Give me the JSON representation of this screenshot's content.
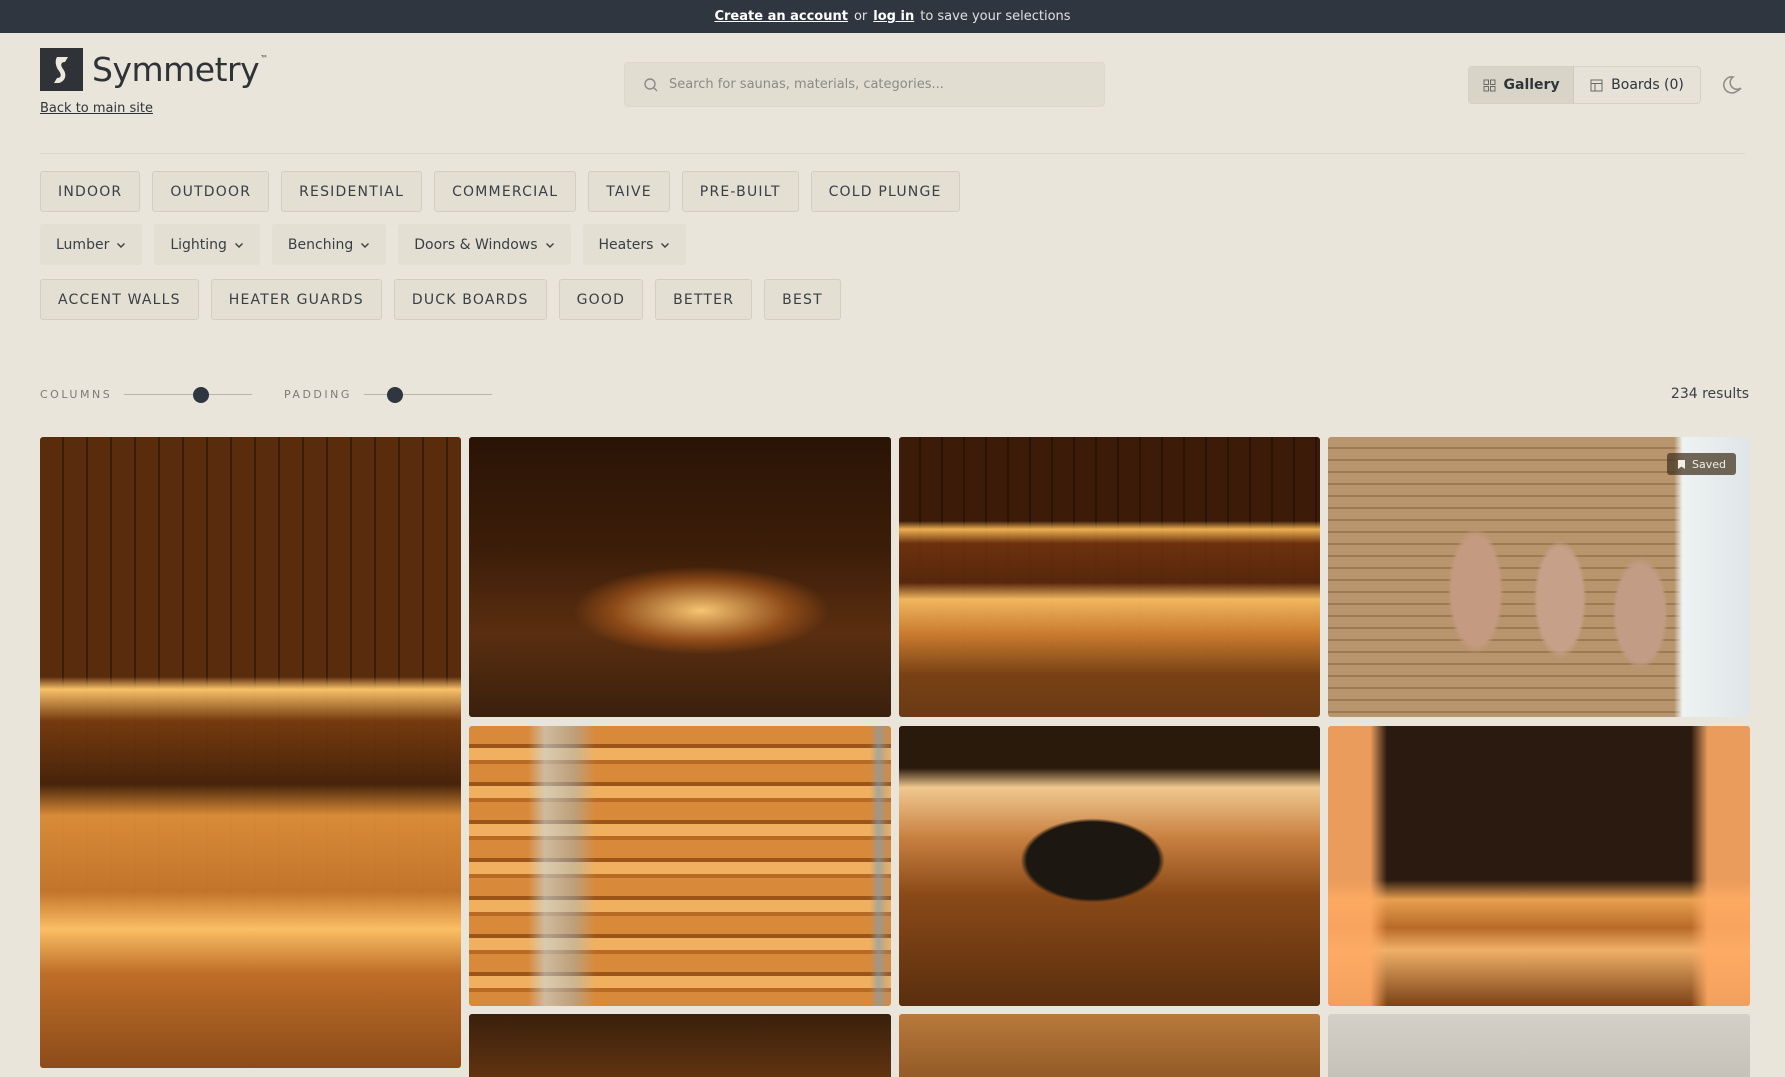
{
  "banner": {
    "create_account": "Create an account",
    "or": "or",
    "log_in": "log in",
    "suffix": "to save your selections"
  },
  "header": {
    "brand": "Symmetry",
    "trademark": "™",
    "back_link": "Back to main site",
    "search_placeholder": "Search for saunas, materials, categories...",
    "gallery_label": "Gallery",
    "boards_label": "Boards (0)"
  },
  "filters": {
    "categories": [
      "INDOOR",
      "OUTDOOR",
      "RESIDENTIAL",
      "COMMERCIAL",
      "TAIVE",
      "PRE-BUILT",
      "COLD PLUNGE"
    ],
    "dropdowns": [
      "Lumber",
      "Lighting",
      "Benching",
      "Doors & Windows",
      "Heaters"
    ],
    "tags": [
      "ACCENT WALLS",
      "HEATER GUARDS",
      "DUCK BOARDS",
      "GOOD",
      "BETTER",
      "BEST"
    ]
  },
  "controls": {
    "columns_label": "COLUMNS",
    "padding_label": "PADDING",
    "results": "234 results",
    "columns_level": 0.6,
    "padding_level": 0.24
  },
  "gallery": {
    "saved_label": "Saved"
  },
  "colors": {
    "background": "#e9e5da",
    "banner": "#2f3640",
    "wood_glow": "#e8a040"
  }
}
